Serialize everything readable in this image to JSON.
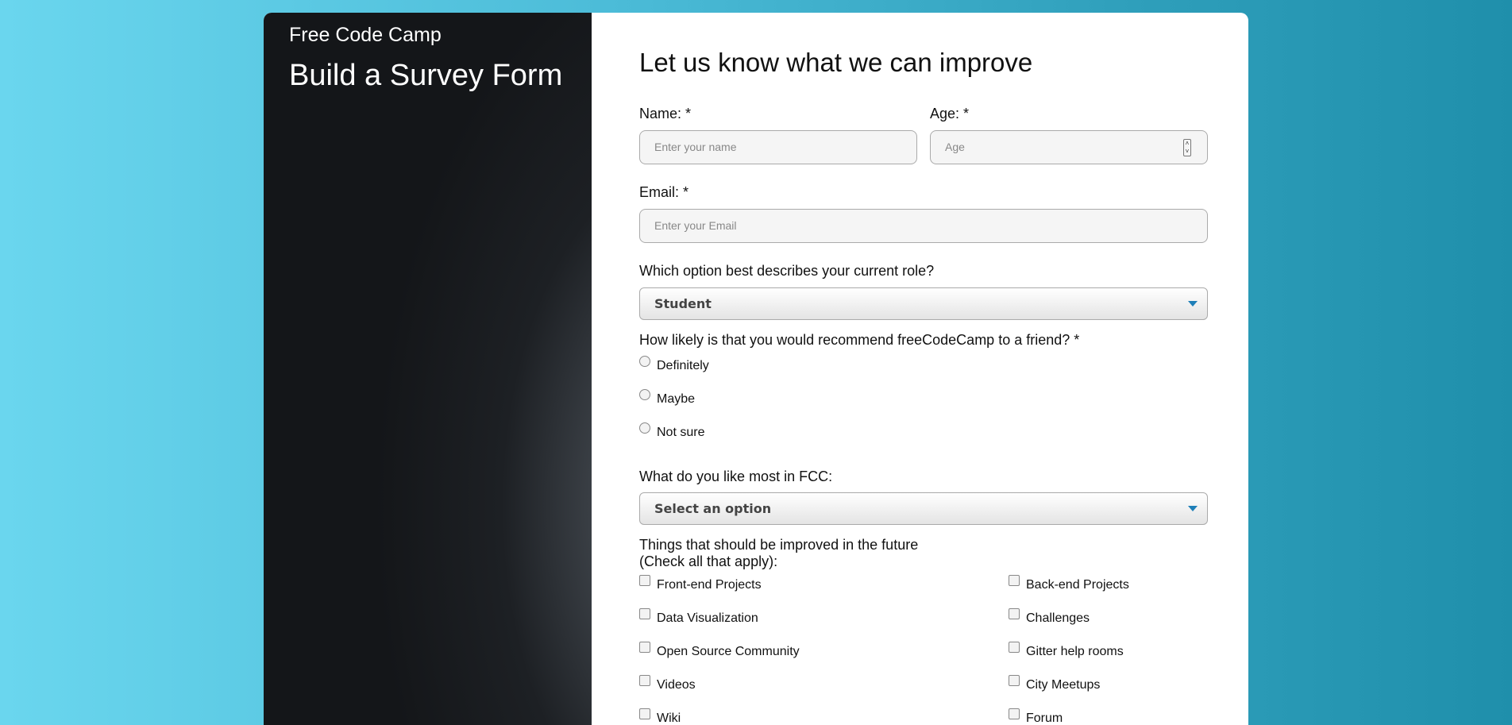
{
  "sidebar": {
    "brand": "Free Code Camp",
    "title": "Build a Survey Form"
  },
  "form": {
    "heading": "Let us know what we can improve",
    "name": {
      "label": "Name: *",
      "placeholder": "Enter your name"
    },
    "age": {
      "label": "Age: *",
      "placeholder": "Age"
    },
    "email": {
      "label": "Email: *",
      "placeholder": "Enter your Email"
    },
    "role": {
      "label": "Which option best describes your current role?",
      "selected": "Student"
    },
    "recommend": {
      "label": "How likely is that you would recommend freeCodeCamp to a friend? *",
      "options": [
        "Definitely",
        "Maybe",
        "Not sure"
      ]
    },
    "like": {
      "label": "What do you like most in FCC:",
      "selected": "Select an option"
    },
    "improve": {
      "label_line1": "Things that should be improved in the future",
      "label_line2": "(Check all that apply):",
      "options_left": [
        "Front-end Projects",
        "Data Visualization",
        "Open Source Community",
        "Videos",
        "Wiki"
      ],
      "options_right": [
        "Back-end Projects",
        "Challenges",
        "Gitter help rooms",
        "City Meetups",
        "Forum"
      ]
    }
  },
  "colors": {
    "accent": "#1e7fb8",
    "background_light": "#6ad6ee",
    "background_dark": "#1f8fab",
    "sidebar": "#141619"
  },
  "icons": {
    "select_caret": "chevron-down-icon",
    "number_spinner": "spinner-icon"
  }
}
